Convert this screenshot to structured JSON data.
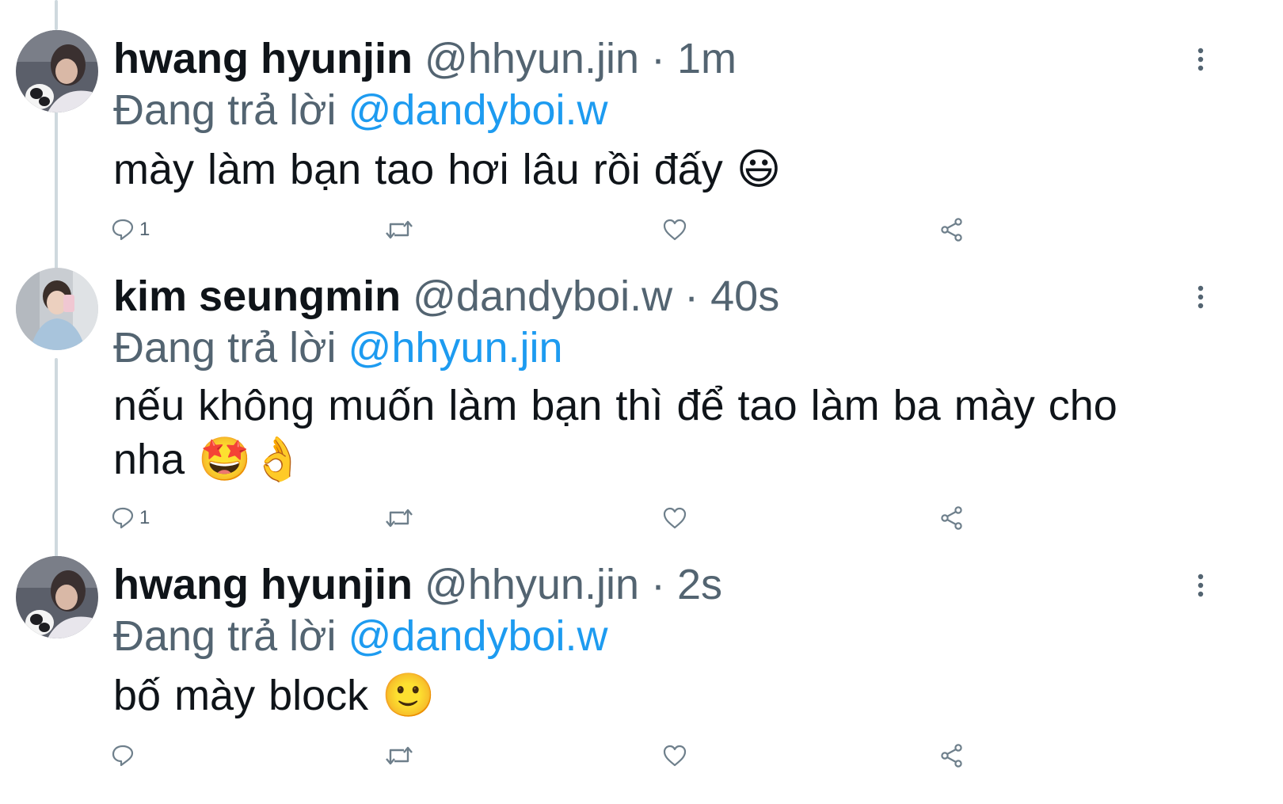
{
  "tweets": [
    {
      "name": "hwang hyunjin",
      "handle": "@hhyun.jin",
      "separator": "·",
      "time": "1m",
      "replying_label": "Đang trả lời",
      "replying_to": "@dandyboi.w",
      "text": "mày làm bạn tao hơi lâu rồi đấy",
      "emoji": "😃",
      "reply_count": "1",
      "avatar_icon": "user-photo-icon"
    },
    {
      "name": "kim seungmin",
      "handle": "@dandyboi.w",
      "separator": "·",
      "time": "40s",
      "replying_label": "Đang trả lời",
      "replying_to": "@hhyun.jin",
      "text_line1": "nếu không muốn làm bạn thì để tao làm ba mày cho",
      "text_line2": "nha",
      "emoji": "🤩👌",
      "reply_count": "1",
      "avatar_icon": "user-photo-icon"
    },
    {
      "name": "hwang hyunjin",
      "handle": "@hhyun.jin",
      "separator": "·",
      "time": "2s",
      "replying_label": "Đang trả lời",
      "replying_to": "@dandyboi.w",
      "text": "bố mày block",
      "emoji": "🙂",
      "reply_count": "",
      "avatar_icon": "user-photo-icon"
    }
  ],
  "icons": {
    "reply": "reply-icon",
    "retweet": "retweet-icon",
    "like": "heart-icon",
    "share": "share-icon",
    "more": "more-vertical-icon"
  },
  "colors": {
    "text": "#0f1419",
    "secondary": "#536471",
    "mention": "#1d9bf0",
    "thread_line": "#cfd9de",
    "icon": "#6e7f8b"
  }
}
